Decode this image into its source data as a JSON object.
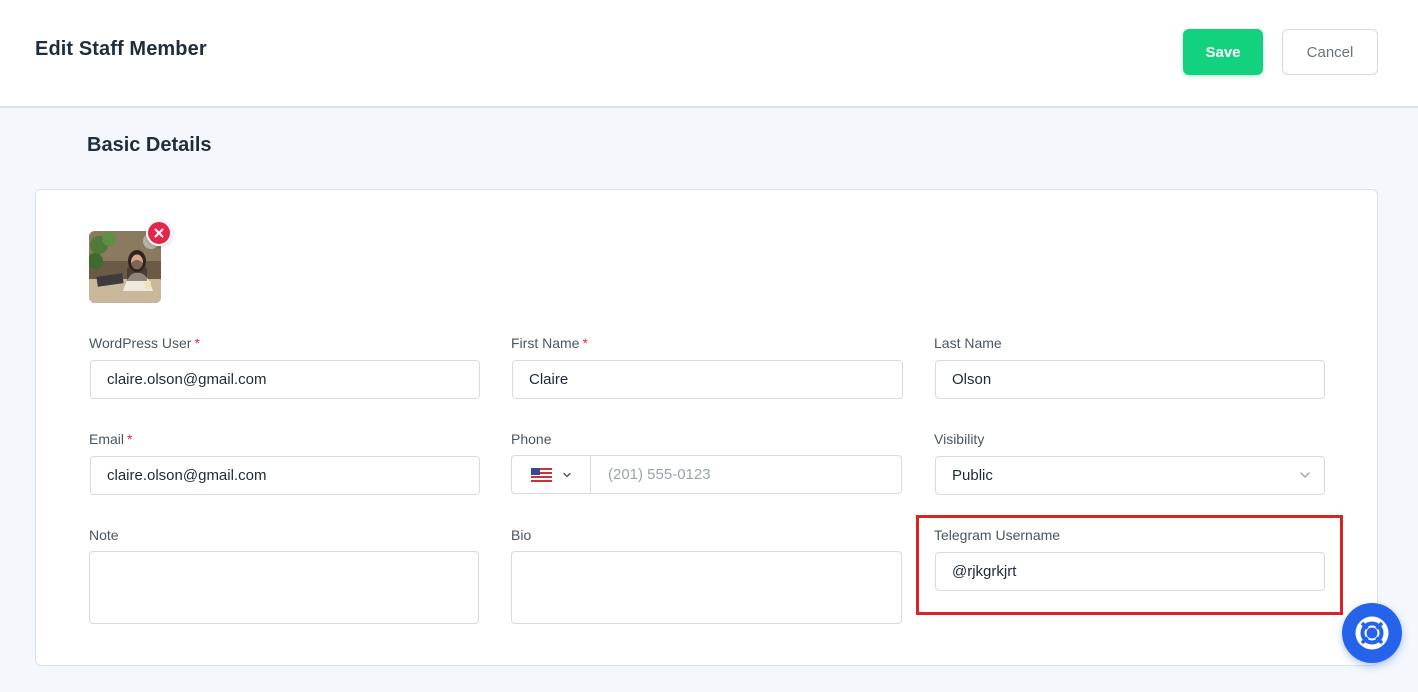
{
  "header": {
    "title": "Edit Staff Member",
    "save_label": "Save",
    "cancel_label": "Cancel"
  },
  "section": {
    "title": "Basic Details"
  },
  "form": {
    "wordpress_user": {
      "label": "WordPress User",
      "required_mark": "*",
      "value": "claire.olson@gmail.com"
    },
    "first_name": {
      "label": "First Name",
      "required_mark": "*",
      "value": "Claire"
    },
    "last_name": {
      "label": "Last Name",
      "value": "Olson"
    },
    "email": {
      "label": "Email",
      "required_mark": "*",
      "value": "claire.olson@gmail.com"
    },
    "phone": {
      "label": "Phone",
      "placeholder": "(201) 555-0123",
      "country_flag": "us-flag-icon"
    },
    "visibility": {
      "label": "Visibility",
      "value": "Public"
    },
    "note": {
      "label": "Note",
      "value": ""
    },
    "bio": {
      "label": "Bio",
      "value": ""
    },
    "telegram": {
      "label": "Telegram Username",
      "value": "@rjkgrkjrt"
    }
  },
  "colors": {
    "accent_save": "#12d27f",
    "required": "#e5264a",
    "highlight": "#d92424",
    "help_button": "#2563eb"
  },
  "icons": {
    "avatar_remove": "close-icon",
    "phone_dropdown": "chevron-down-icon",
    "visibility_dropdown": "chevron-down-icon",
    "help": "lifebuoy-icon"
  }
}
